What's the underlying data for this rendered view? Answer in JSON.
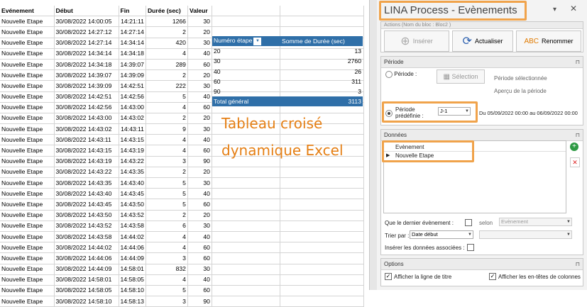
{
  "sheet": {
    "headers": [
      "Evénement",
      "Début",
      "Fin",
      "Durée (sec)",
      "Valeur"
    ],
    "rows": [
      [
        "Nouvelle Etape",
        "30/08/2022 14:00:05",
        "14:21:11",
        "1266",
        "30"
      ],
      [
        "Nouvelle Etape",
        "30/08/2022 14:27:12",
        "14:27:14",
        "2",
        "20"
      ],
      [
        "Nouvelle Etape",
        "30/08/2022 14:27:14",
        "14:34:14",
        "420",
        "30"
      ],
      [
        "Nouvelle Etape",
        "30/08/2022 14:34:14",
        "14:34:18",
        "4",
        "40"
      ],
      [
        "Nouvelle Etape",
        "30/08/2022 14:34:18",
        "14:39:07",
        "289",
        "60"
      ],
      [
        "Nouvelle Etape",
        "30/08/2022 14:39:07",
        "14:39:09",
        "2",
        "20"
      ],
      [
        "Nouvelle Etape",
        "30/08/2022 14:39:09",
        "14:42:51",
        "222",
        "30"
      ],
      [
        "Nouvelle Etape",
        "30/08/2022 14:42:51",
        "14:42:56",
        "5",
        "40"
      ],
      [
        "Nouvelle Etape",
        "30/08/2022 14:42:56",
        "14:43:00",
        "4",
        "60"
      ],
      [
        "Nouvelle Etape",
        "30/08/2022 14:43:00",
        "14:43:02",
        "2",
        "20"
      ],
      [
        "Nouvelle Etape",
        "30/08/2022 14:43:02",
        "14:43:11",
        "9",
        "30"
      ],
      [
        "Nouvelle Etape",
        "30/08/2022 14:43:11",
        "14:43:15",
        "4",
        "40"
      ],
      [
        "Nouvelle Etape",
        "30/08/2022 14:43:15",
        "14:43:19",
        "4",
        "60"
      ],
      [
        "Nouvelle Etape",
        "30/08/2022 14:43:19",
        "14:43:22",
        "3",
        "90"
      ],
      [
        "Nouvelle Etape",
        "30/08/2022 14:43:22",
        "14:43:35",
        "2",
        "20"
      ],
      [
        "Nouvelle Etape",
        "30/08/2022 14:43:35",
        "14:43:40",
        "5",
        "30"
      ],
      [
        "Nouvelle Etape",
        "30/08/2022 14:43:40",
        "14:43:45",
        "5",
        "40"
      ],
      [
        "Nouvelle Etape",
        "30/08/2022 14:43:45",
        "14:43:50",
        "5",
        "60"
      ],
      [
        "Nouvelle Etape",
        "30/08/2022 14:43:50",
        "14:43:52",
        "2",
        "20"
      ],
      [
        "Nouvelle Etape",
        "30/08/2022 14:43:52",
        "14:43:58",
        "6",
        "30"
      ],
      [
        "Nouvelle Etape",
        "30/08/2022 14:43:58",
        "14:44:02",
        "4",
        "40"
      ],
      [
        "Nouvelle Etape",
        "30/08/2022 14:44:02",
        "14:44:06",
        "4",
        "60"
      ],
      [
        "Nouvelle Etape",
        "30/08/2022 14:44:06",
        "14:44:09",
        "3",
        "60"
      ],
      [
        "Nouvelle Etape",
        "30/08/2022 14:44:09",
        "14:58:01",
        "832",
        "30"
      ],
      [
        "Nouvelle Etape",
        "30/08/2022 14:58:01",
        "14:58:05",
        "4",
        "40"
      ],
      [
        "Nouvelle Etape",
        "30/08/2022 14:58:05",
        "14:58:10",
        "5",
        "60"
      ],
      [
        "Nouvelle Etape",
        "30/08/2022 14:58:10",
        "14:58:13",
        "3",
        "90"
      ]
    ]
  },
  "pivot": {
    "col1": "Numéro étape",
    "col2": "Somme de Durée (sec)",
    "rows": [
      [
        "20",
        "13"
      ],
      [
        "30",
        "2760"
      ],
      [
        "40",
        "26"
      ],
      [
        "60",
        "311"
      ],
      [
        "90",
        "3"
      ]
    ],
    "total_label": "Total général",
    "total_value": "3113"
  },
  "annotation": {
    "line1": "Tableau croisé",
    "line2": "dynamique Excel"
  },
  "pane": {
    "title": "LINA Process - Evènements",
    "actions_header": "Actions (Nom du bloc : Bloc2 )",
    "btn_insert": "Insérer",
    "btn_refresh": "Actualiser",
    "btn_rename": "Renommer",
    "period_header": "Période",
    "period_label": "Période :",
    "btn_selection": "Sélection",
    "selected_period": "Période sélectionnée",
    "period_preview": "Aperçu de la période",
    "predefined_label_1": "Période",
    "predefined_label_2": "prédéfinie :",
    "predefined_value": "J-1",
    "predefined_range": "Du 05/09/2022 00:00 au 06/09/2022 00:00",
    "data_header": "Données",
    "list_header": "Evènement",
    "list_item": "Nouvelle Etape",
    "last_event_label": "Que le dernier évènement :",
    "according_label": "selon",
    "according_value": "Evènement",
    "sort_label": "Trier par :",
    "sort_value": "Date début",
    "insert_assoc_label": "Insérer les données associées :",
    "options_header": "Options",
    "opt_show_title": "Afficher la ligne de titre",
    "opt_show_col_headers": "Afficher les en-têtes de colonnes"
  },
  "colors": {
    "accent_orange": "#f0a34b",
    "pivot_blue": "#2f6fa8",
    "annotation_orange": "#e57f14"
  }
}
